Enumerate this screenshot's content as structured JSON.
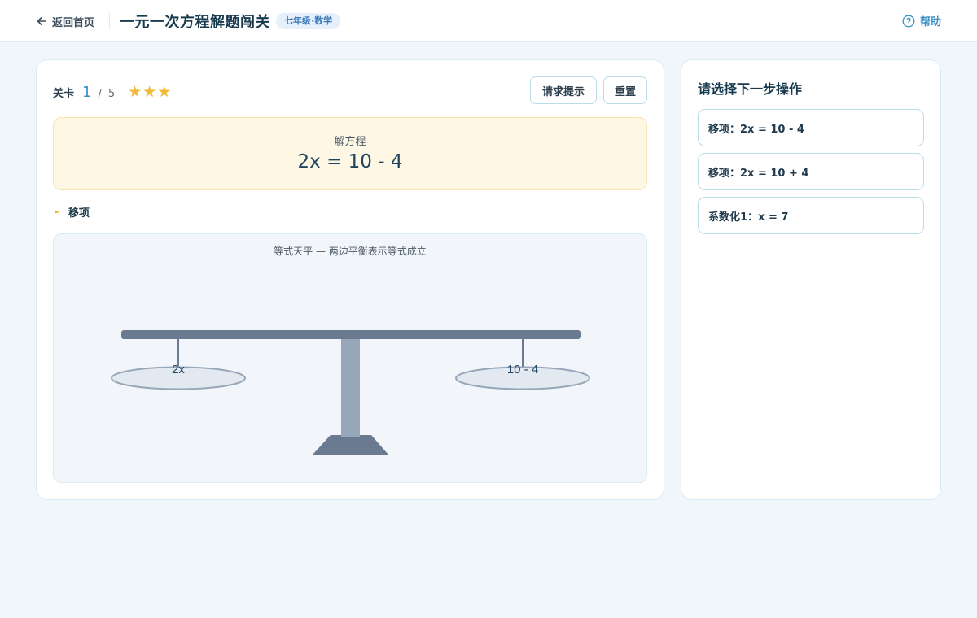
{
  "header": {
    "back_label": "返回首页",
    "title": "一元一次方程解题闯关",
    "grade_badge": "七年级·数学",
    "help_label": "帮助"
  },
  "level": {
    "label": "关卡",
    "current": "1",
    "separator": "/",
    "total": "5",
    "stars": "★★★",
    "star_count": 3
  },
  "actions": {
    "hint_label": "请求提示",
    "reset_label": "重置"
  },
  "equation": {
    "label": "解方程",
    "value": "2x = 10 - 4"
  },
  "step": {
    "label": "移项"
  },
  "balance": {
    "caption": "等式天平 — 两边平衡表示等式成立",
    "left": "2x",
    "right": "10 - 4"
  },
  "options": {
    "title": "请选择下一步操作",
    "items": [
      {
        "label": "移项：2x = 10 - 4"
      },
      {
        "label": "移项：2x = 10 + 4"
      },
      {
        "label": "系数化1：x = 7"
      }
    ]
  },
  "colors": {
    "accent": "#3b8ec8",
    "star": "#f2b934",
    "equation_bg": "#fef7e3",
    "beam": "#6a7a90",
    "post": "#97a6b8"
  },
  "icons": {
    "back": "arrow-left-icon",
    "help": "question-circle-icon",
    "step": "triangle-right-icon"
  }
}
